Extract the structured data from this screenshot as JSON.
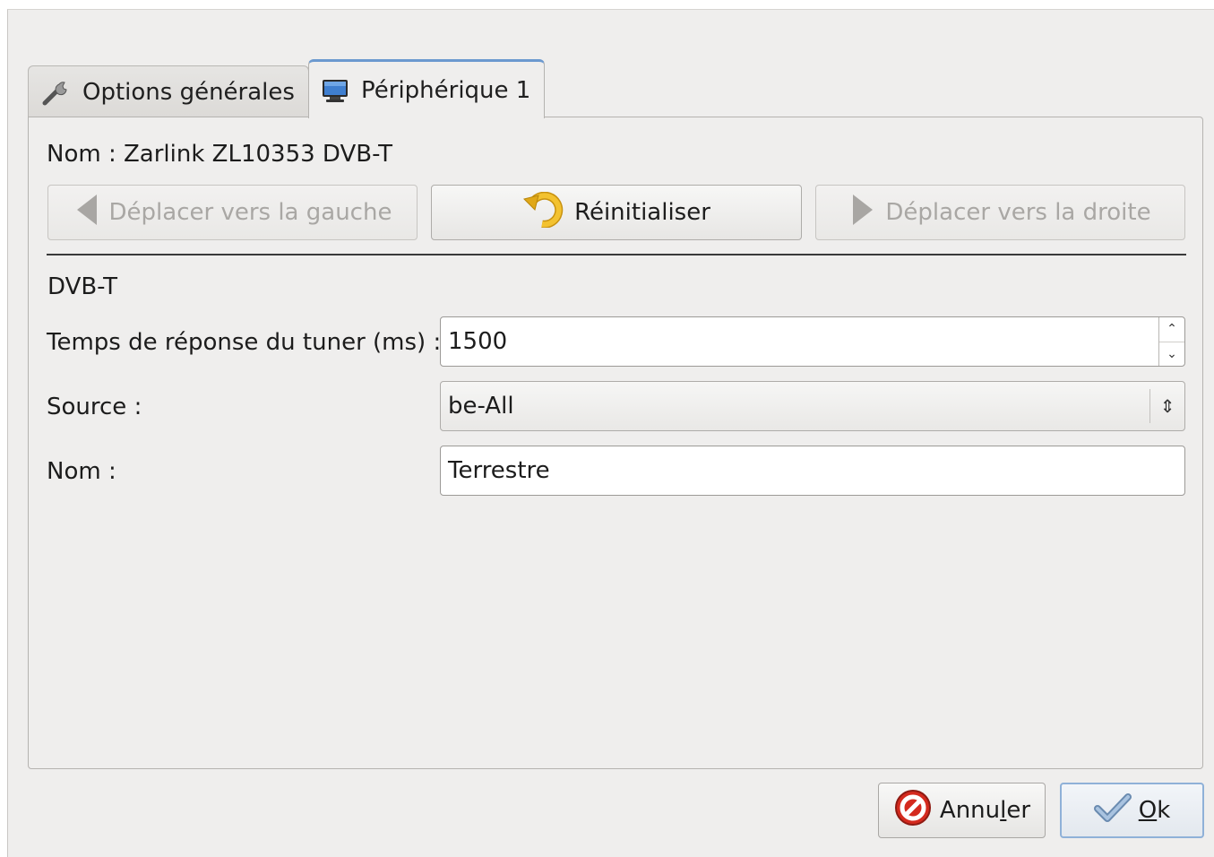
{
  "tabs": [
    {
      "label": "Options générales",
      "icon": "wrench-icon",
      "active": false
    },
    {
      "label": "Périphérique 1",
      "icon": "monitor-icon",
      "active": true
    }
  ],
  "device": {
    "name_label": "Nom : Zarlink ZL10353 DVB-T"
  },
  "actions": {
    "move_left": "Déplacer vers la gauche",
    "reset": "Réinitialiser",
    "move_right": "Déplacer vers la droite"
  },
  "section": {
    "title": "DVB-T"
  },
  "form": {
    "tuner_label": "Temps de réponse du tuner (ms) :",
    "tuner_value": "1500",
    "source_label": "Source :",
    "source_value": "be-All",
    "name_label": "Nom :",
    "name_value": "Terrestre"
  },
  "footer": {
    "cancel": {
      "before": "Annu",
      "mnemonic": "l",
      "after": "er"
    },
    "ok": {
      "mnemonic": "O",
      "after": "k"
    }
  },
  "colors": {
    "accent": "#6b99cf",
    "window_bg": "#efeeed"
  }
}
